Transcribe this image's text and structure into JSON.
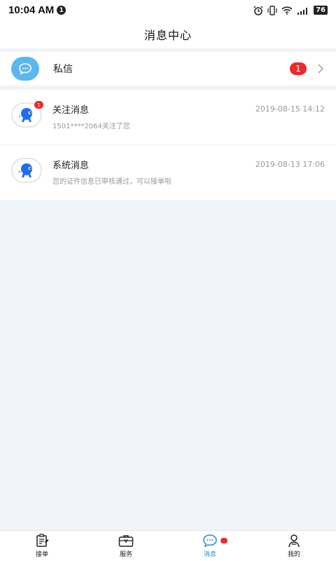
{
  "status_bar": {
    "time": "10:04 AM",
    "notif_count": "1",
    "battery": "76"
  },
  "header": {
    "title": "消息中心"
  },
  "private_message": {
    "label": "私信",
    "badge": "1"
  },
  "messages": [
    {
      "title": "关注消息",
      "time": "2019-08-15 14:12",
      "preview": "1501****2064关注了您",
      "badge": "1"
    },
    {
      "title": "系统消息",
      "time": "2019-08-13 17:06",
      "preview": "您的证件信息已审核通过，可以接单啦"
    }
  ],
  "tabbar": {
    "tabs": [
      {
        "label": "接单",
        "icon": "clipboard-icon"
      },
      {
        "label": "服务",
        "icon": "toolbox-icon"
      },
      {
        "label": "消息",
        "icon": "chat-icon",
        "active": true
      },
      {
        "label": "我的",
        "icon": "user-icon"
      }
    ]
  },
  "colors": {
    "accent": "#1e88e5",
    "badge": "#ee2a2a",
    "pm_icon_bg": "#5cb6f2",
    "page_bg": "#f1f4f8"
  }
}
